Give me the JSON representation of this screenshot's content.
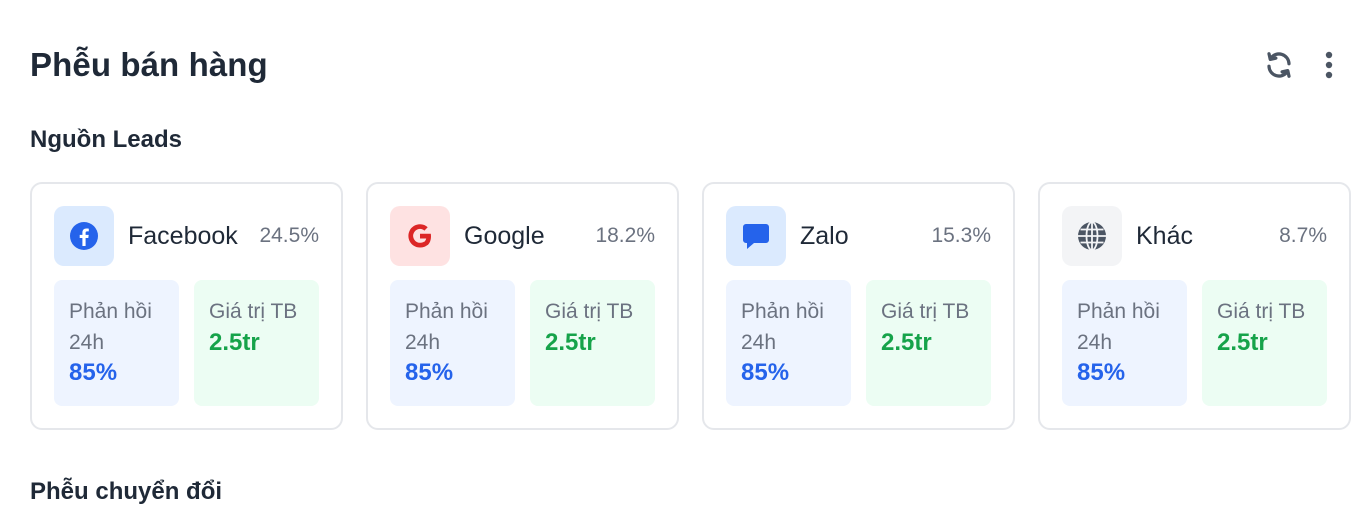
{
  "header": {
    "title": "Phễu bán hàng",
    "refresh_icon": "refresh-icon",
    "more_icon": "more-vertical-icon"
  },
  "sections": {
    "leads_title": "Nguồn Leads",
    "funnel_title": "Phễu chuyển đổi"
  },
  "sources": [
    {
      "name": "Facebook",
      "percent": "24.5%",
      "icon": "facebook-icon",
      "icon_color": "#2563eb",
      "icon_bg": "#dbeafe",
      "response_label": "Phản hồi 24h",
      "response_value": "85%",
      "avg_label": "Giá trị TB",
      "avg_value": "2.5tr"
    },
    {
      "name": "Google",
      "percent": "18.2%",
      "icon": "google-icon",
      "icon_color": "#dc2626",
      "icon_bg": "#fee2e2",
      "response_label": "Phản hồi 24h",
      "response_value": "85%",
      "avg_label": "Giá trị TB",
      "avg_value": "2.5tr"
    },
    {
      "name": "Zalo",
      "percent": "15.3%",
      "icon": "chat-bubble-icon",
      "icon_color": "#2563eb",
      "icon_bg": "#dbeafe",
      "response_label": "Phản hồi 24h",
      "response_value": "85%",
      "avg_label": "Giá trị TB",
      "avg_value": "2.5tr"
    },
    {
      "name": "Khác",
      "percent": "8.7%",
      "icon": "globe-icon",
      "icon_color": "#4b5563",
      "icon_bg": "#f3f4f6",
      "response_label": "Phản hồi 24h",
      "response_value": "85%",
      "avg_label": "Giá trị TB",
      "avg_value": "2.5tr"
    }
  ],
  "colors": {
    "primary_blue": "#2563eb",
    "success_green": "#16a34a",
    "muted_text": "#6b7280",
    "border": "#e5e7eb"
  }
}
